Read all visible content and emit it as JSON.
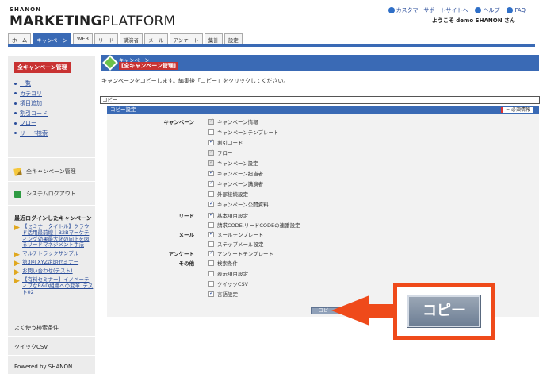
{
  "header": {
    "brand_top": "SHANON",
    "brand_strong": "MARKETING",
    "brand_light": "PLATFORM",
    "links": [
      "カスタマーサポートサイトへ",
      "ヘルプ",
      "FAQ"
    ],
    "welcome": "ようこそ demo SHANON さん",
    "tabs": [
      "ホーム",
      "キャンペーン",
      "WEB",
      "リード",
      "講演者",
      "メール",
      "アンケート",
      "集計",
      "設定"
    ]
  },
  "sidebar": {
    "title": "全キャンペーン管理",
    "items": [
      "一覧",
      "カテゴリ",
      "項目追加",
      "割引コード",
      "フロー",
      "リード検索"
    ],
    "all_campaigns": "全キャンペーン管理",
    "logout": "システムログアウト",
    "recent_title": "最近ログインしたキャンペーン",
    "recent": [
      "【セミナータイトル】クラウド活用最前線｜B2Bマーケティング効果最大化の向上を図るリードマネジメント手法",
      "マルチトラックサンプル",
      "第3回 XYZ定期セミナー",
      "お問い合わせ(テスト)",
      "【有料セミナー】イノベーティブなR&D組織への変革_テスト02"
    ],
    "search_cond": "よく使う検索条件",
    "quick_csv": "クイックCSV",
    "powered": "Powered by SHANON"
  },
  "main": {
    "head_sub": "キャンペーン",
    "head_title": "[全キャンペーン管理]",
    "instruction": "キャンペーンをコピーします。編集後「コピー」をクリックしてください。",
    "copy_label": "コピー",
    "settings_title": "コピー設定",
    "required": "= 必須情報",
    "categories": {
      "campaign": "キャンペーン",
      "lead": "リード",
      "mail": "メール",
      "enquete": "アンケート",
      "other": "その他"
    },
    "items": [
      {
        "label": "キャンペーン情報",
        "checked": true,
        "disabled": true
      },
      {
        "label": "キャンペーンテンプレート",
        "checked": false,
        "disabled": false
      },
      {
        "label": "割引コード",
        "checked": true,
        "disabled": false
      },
      {
        "label": "フロー",
        "checked": true,
        "disabled": true
      },
      {
        "label": "キャンペーン設定",
        "checked": true,
        "disabled": true
      },
      {
        "label": "キャンペーン担当者",
        "checked": true,
        "disabled": false
      },
      {
        "label": "キャンペーン講演者",
        "checked": true,
        "disabled": false
      },
      {
        "label": "外部接続設定",
        "checked": false,
        "disabled": false
      },
      {
        "label": "キャンペーン公開資料",
        "checked": true,
        "disabled": false
      },
      {
        "label": "基本項目設定",
        "checked": true,
        "disabled": false
      },
      {
        "label": "請求CODE,リードCODEの連番設定",
        "checked": false,
        "disabled": false
      },
      {
        "label": "メールテンプレート",
        "checked": true,
        "disabled": false
      },
      {
        "label": "ステップメール設定",
        "checked": false,
        "disabled": false
      },
      {
        "label": "アンケートテンプレート",
        "checked": true,
        "disabled": false
      },
      {
        "label": "検索条件",
        "checked": false,
        "disabled": false
      },
      {
        "label": "表示項目設定",
        "checked": false,
        "disabled": false
      },
      {
        "label": "クイックCSV",
        "checked": false,
        "disabled": false
      },
      {
        "label": "言語設定",
        "checked": true,
        "disabled": false
      }
    ],
    "copy_button": "コピー",
    "zoom_copy_button": "コピー"
  },
  "colors": {
    "accent": "#3a6ab5",
    "title_red": "#c83232",
    "callout": "#ef4a1a"
  }
}
